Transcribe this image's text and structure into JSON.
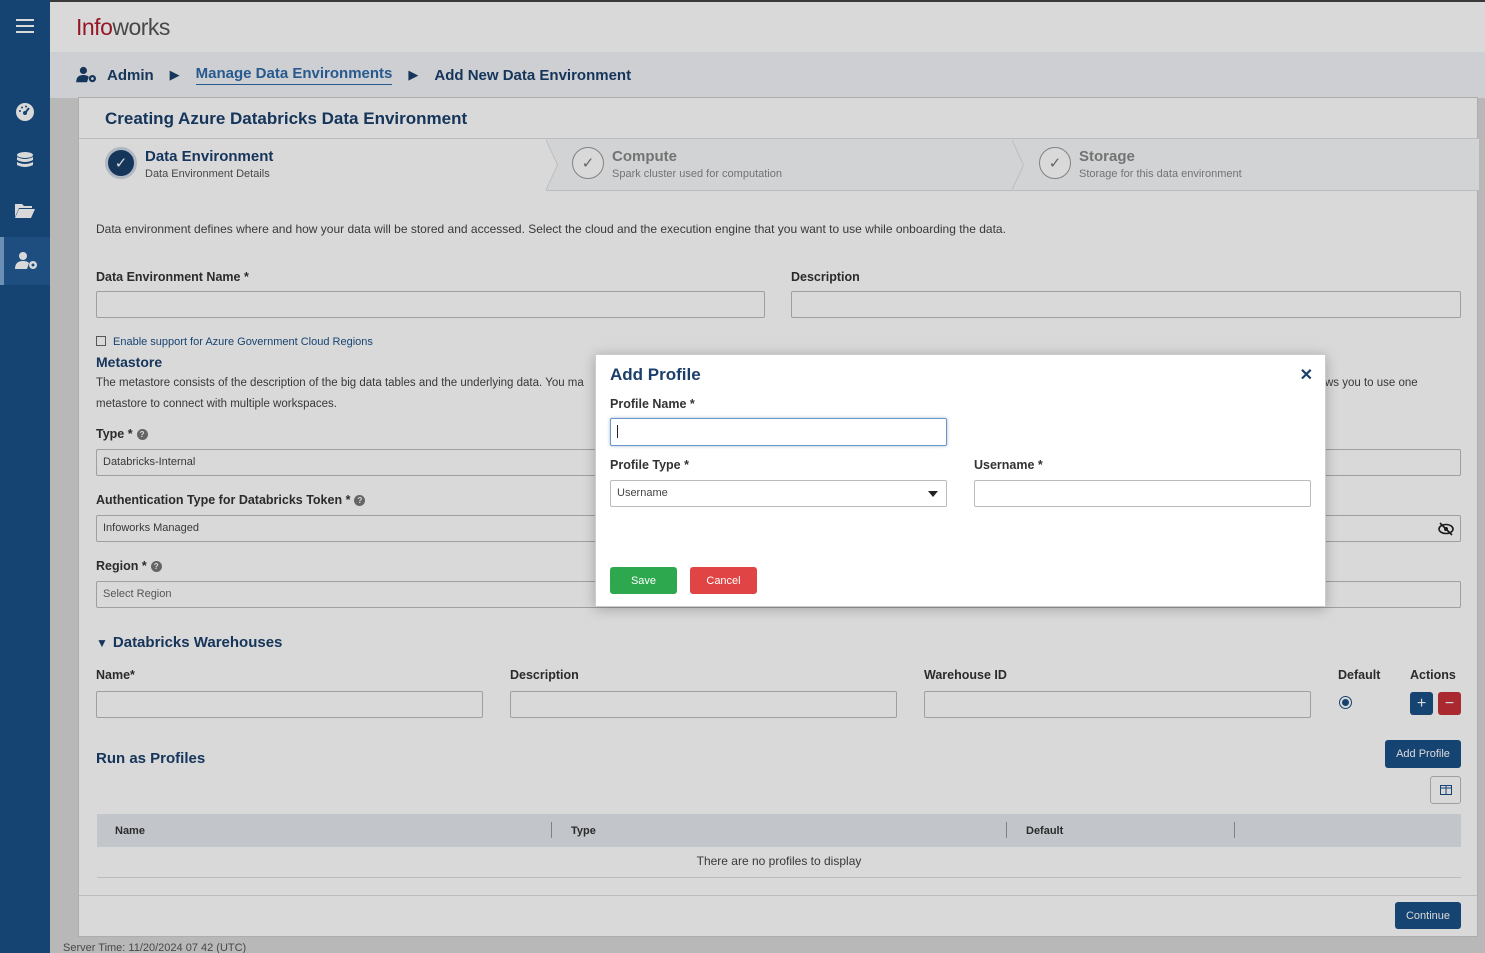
{
  "app": {
    "logo_part1": "Info",
    "logo_part2": "works"
  },
  "sidebar": {
    "items": [
      {
        "name": "dashboard",
        "icon": "gauge-icon"
      },
      {
        "name": "data-sources",
        "icon": "database-icon"
      },
      {
        "name": "files",
        "icon": "folder-icon"
      },
      {
        "name": "admin",
        "icon": "user-gear-icon",
        "active": true
      }
    ]
  },
  "breadcrumb": {
    "root": "Admin",
    "middle": "Manage Data Environments",
    "current": "Add New Data Environment"
  },
  "page": {
    "title": "Creating Azure Databricks Data Environment",
    "steps": [
      {
        "title": "Data Environment",
        "subtitle": "Data Environment Details",
        "status": "done"
      },
      {
        "title": "Compute",
        "subtitle": "Spark cluster used for computation",
        "status": "pending"
      },
      {
        "title": "Storage",
        "subtitle": "Storage for this data environment",
        "status": "pending"
      }
    ],
    "intro": "Data environment defines where and how your data will be stored and accessed. Select the cloud and the execution engine that you want to use while onboarding the data.",
    "env_name_label": "Data Environment Name *",
    "description_label": "Description",
    "gov_cloud_label": "Enable support for Azure Government Cloud Regions",
    "metastore": {
      "title": "Metastore",
      "desc_left": "The metastore consists of the description of the big data tables and the underlying data. You ma",
      "desc_right": "ws you to use one",
      "desc_line2": "metastore to connect with multiple workspaces.",
      "type_label": "Type *",
      "type_value": "Databricks-Internal",
      "auth_label": "Authentication Type for Databricks Token *",
      "auth_value": "Infoworks Managed",
      "region_label": "Region *",
      "region_placeholder": "Select Region"
    },
    "warehouses": {
      "title": "Databricks Warehouses",
      "col_name": "Name*",
      "col_description": "Description",
      "col_warehouse_id": "Warehouse ID",
      "col_default": "Default",
      "col_actions": "Actions"
    },
    "profiles": {
      "title": "Run as Profiles",
      "add_button": "Add Profile",
      "columns": [
        "Name",
        "Type",
        "Default"
      ],
      "empty_text": "There are no profiles to display"
    },
    "continue_button": "Continue",
    "server_time": "Server Time: 11/20/2024 07 42 (UTC)"
  },
  "modal": {
    "title": "Add Profile",
    "profile_name_label": "Profile Name *",
    "profile_name_value": "",
    "profile_type_label": "Profile Type *",
    "profile_type_value": "Username",
    "username_label": "Username *",
    "username_value": "",
    "save_label": "Save",
    "cancel_label": "Cancel"
  },
  "colors": {
    "sidebar": "#1b5086",
    "primary": "#1b5086",
    "heading": "#1b3f6b",
    "save": "#2ea84f",
    "cancel": "#e04444",
    "remove": "#c8313a"
  }
}
